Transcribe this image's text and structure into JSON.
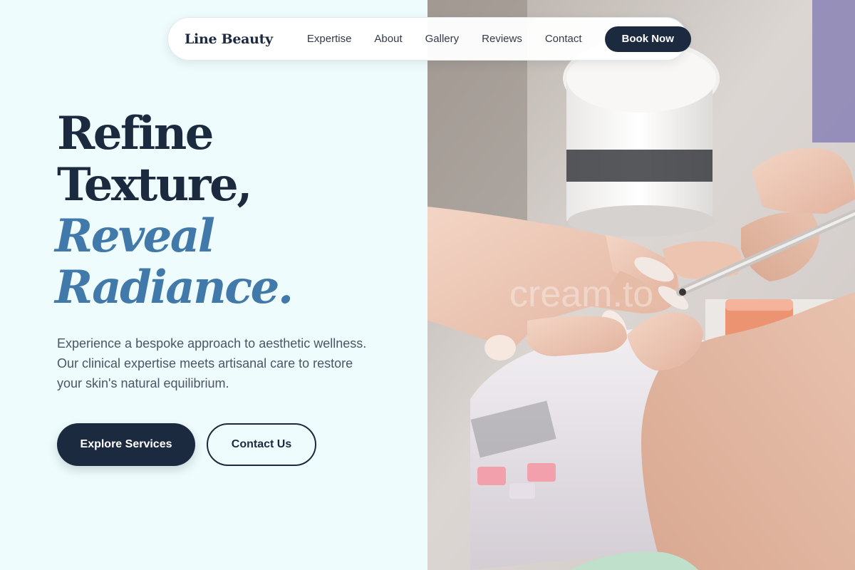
{
  "navbar": {
    "brand": "Line Beauty",
    "links": [
      "Expertise",
      "About",
      "Gallery",
      "Reviews",
      "Contact"
    ],
    "cta_label": "Book Now"
  },
  "hero": {
    "headline": {
      "line1": "Refine",
      "line2": "Texture,",
      "line3": "Reveal",
      "line4": "Radiance."
    },
    "lead": "Experience a bespoke approach to aesthetic wellness. Our clinical expertise meets artisanal care to restore your skin's natural equilibrium.",
    "primary_cta": "Explore Services",
    "secondary_cta": "Contact Us"
  },
  "photo": {
    "watermark": "cream.to"
  },
  "colors": {
    "navy": "#1c2a3f",
    "accent_blue": "#4179aa",
    "left_background": "#effcfd",
    "body_text": "#4a5565"
  }
}
